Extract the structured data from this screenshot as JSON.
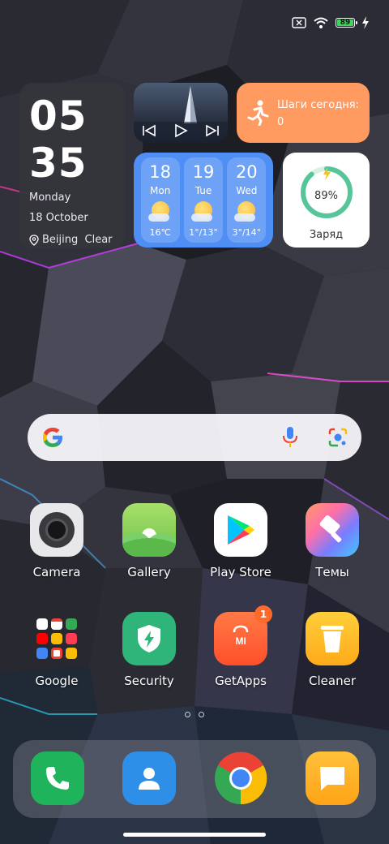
{
  "status": {
    "battery": "89"
  },
  "clock": {
    "hour": "05",
    "minute": "35",
    "day": "Monday",
    "date": "18 October",
    "location": "Beijing  Clear"
  },
  "steps": {
    "label": "Шаги сегодня:",
    "count": "0"
  },
  "weather": {
    "days": [
      {
        "num": "18",
        "dow": "Mon",
        "temp": "16℃"
      },
      {
        "num": "19",
        "dow": "Tue",
        "temp": "1°/13°"
      },
      {
        "num": "20",
        "dow": "Wed",
        "temp": "3°/14°"
      }
    ]
  },
  "charge": {
    "percent": "89%",
    "label": "Заряд"
  },
  "apps": [
    {
      "name": "Camera",
      "icon": "camera-icon"
    },
    {
      "name": "Gallery",
      "icon": "gallery-icon"
    },
    {
      "name": "Play Store",
      "icon": "play-store-icon"
    },
    {
      "name": "Темы",
      "icon": "themes-icon"
    },
    {
      "name": "Google",
      "icon": "google-folder-icon"
    },
    {
      "name": "Security",
      "icon": "security-icon"
    },
    {
      "name": "GetApps",
      "icon": "getapps-icon",
      "badge": "1"
    },
    {
      "name": "Cleaner",
      "icon": "cleaner-icon"
    }
  ],
  "dock": [
    {
      "icon": "phone-icon"
    },
    {
      "icon": "contacts-icon"
    },
    {
      "icon": "chrome-icon"
    },
    {
      "icon": "messages-icon"
    }
  ],
  "colors": {
    "steps_bg": "#ff9a60",
    "weather_bg": "#4f8ef5",
    "battery_green": "#40d65c",
    "badge": "#ff6a2b"
  }
}
